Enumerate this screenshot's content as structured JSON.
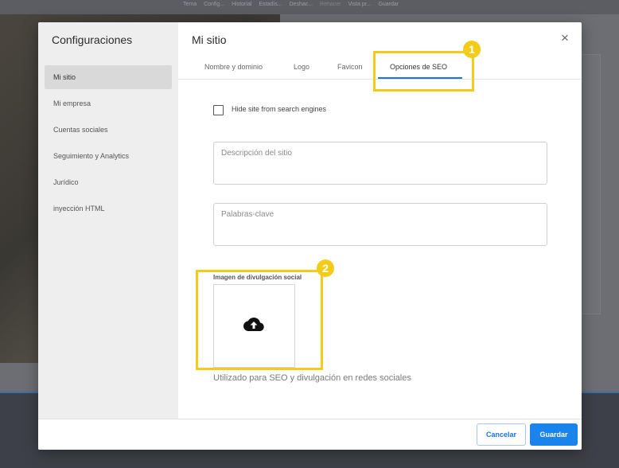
{
  "background_toolbar": [
    "Tema",
    "Config...",
    "Historial",
    "Estadís...",
    "Deshac...",
    "Rehacer",
    "Vista pr...",
    "Guardar"
  ],
  "sidebar": {
    "title": "Configuraciones",
    "items": [
      {
        "label": "Mi sitio",
        "active": true
      },
      {
        "label": "Mi empresa"
      },
      {
        "label": "Cuentas sociales"
      },
      {
        "label": "Seguimiento y Analytics"
      },
      {
        "label": "Jurídico"
      },
      {
        "label": "inyección HTML"
      }
    ]
  },
  "main": {
    "title": "Mi sitio",
    "tabs": [
      {
        "label": "Nombre y dominio"
      },
      {
        "label": "Logo"
      },
      {
        "label": "Favicon"
      },
      {
        "label": "Opciones de SEO",
        "active": true
      }
    ],
    "hide_checkbox": {
      "label": "Hide site from search engines",
      "checked": false
    },
    "description_field": {
      "placeholder": "Descripción del sitio",
      "value": ""
    },
    "keywords_field": {
      "placeholder": "Palabras-clave",
      "value": ""
    },
    "social_image": {
      "label": "Imagen de divulgación social",
      "icon": "cloud-upload-icon"
    },
    "helper_text": "Utilizado para SEO y divulgación en redes sociales"
  },
  "footer": {
    "cancel_label": "Cancelar",
    "save_label": "Guardar"
  },
  "annotations": [
    "1",
    "2"
  ],
  "colors": {
    "accent": "#1a83ec",
    "highlight": "#f3cc1b"
  }
}
